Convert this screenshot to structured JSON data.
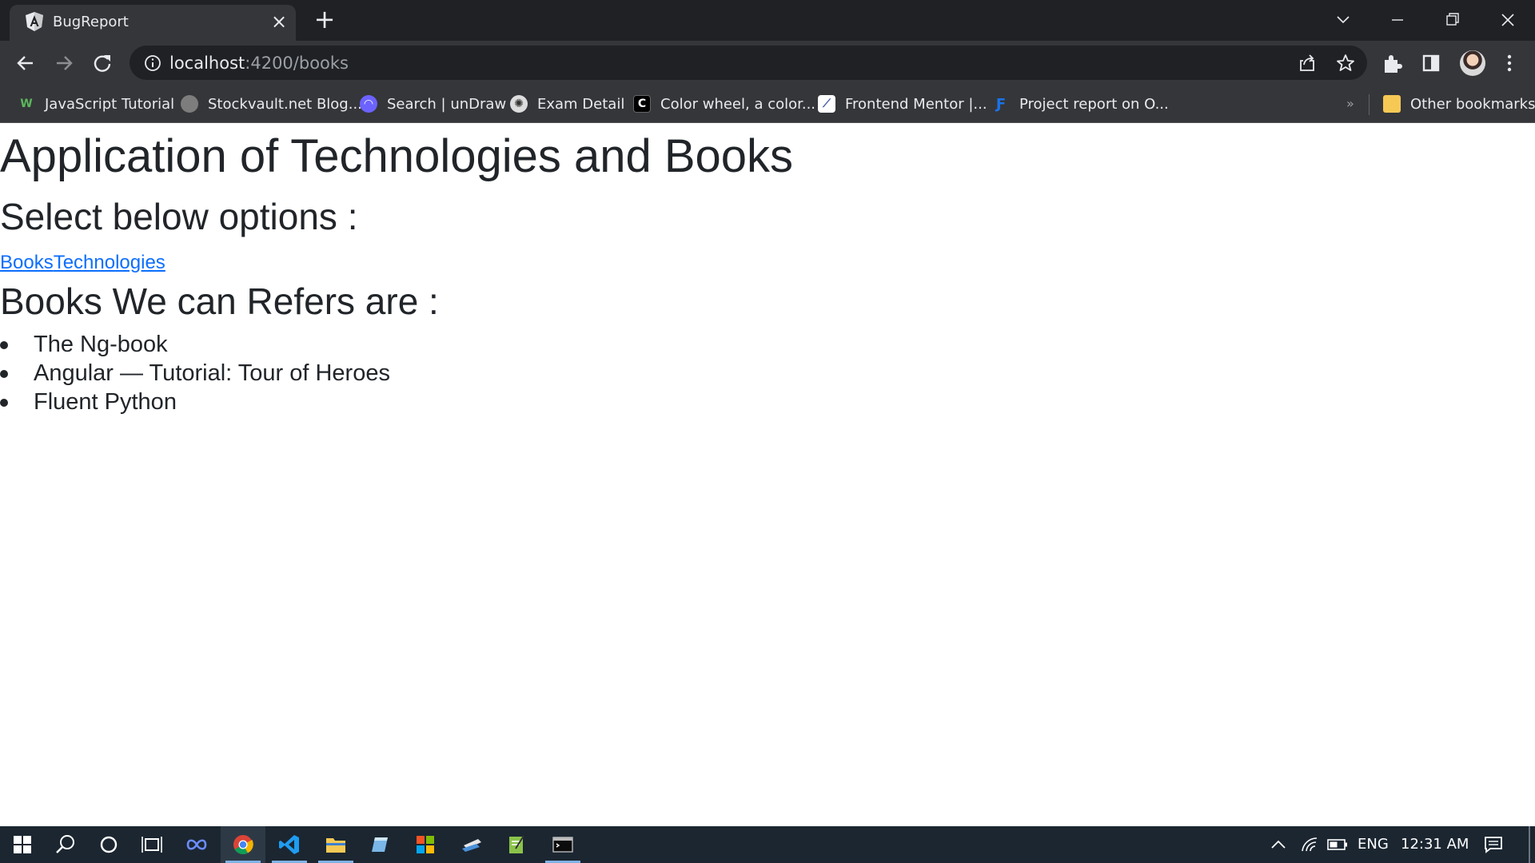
{
  "browser": {
    "tab_title": "BugReport",
    "url_host": "localhost",
    "url_rest": ":4200/books"
  },
  "bookmarks": [
    {
      "label": "JavaScript Tutorial",
      "icon": "w-icon",
      "color": "#5cb85c"
    },
    {
      "label": "Stockvault.net Blog...",
      "icon": "stockvault-icon",
      "color": "#8a8a8a"
    },
    {
      "label": "Search | unDraw",
      "icon": "undraw-icon",
      "color": "#6c63ff"
    },
    {
      "label": "Exam Detail",
      "icon": "exam-icon",
      "color": "#dddddd"
    },
    {
      "label": "Color wheel, a color...",
      "icon": "adobe-color-icon",
      "color": "#000000"
    },
    {
      "label": "Frontend Mentor |...",
      "icon": "frontend-mentor-icon",
      "color": "#ffffff"
    },
    {
      "label": "Project report on O...",
      "icon": "project-report-icon",
      "color": "#1a73e8"
    }
  ],
  "other_bookmarks": "Other bookmarks",
  "page": {
    "title": "Application of Technologies and Books",
    "subtitle": "Select below options :",
    "link_books": "Books",
    "link_technologies": "Technologies",
    "books_heading": "Books We can Refers are :",
    "books": [
      "The Ng-book",
      "Angular — Tutorial: Tour of Heroes",
      "Fluent Python"
    ]
  },
  "taskbar": {
    "language": "ENG",
    "time": "12:31 AM"
  },
  "colors": {
    "link": "#0d6efd",
    "chrome_dark": "#202124",
    "chrome": "#35363a",
    "taskbar": "#1b2631"
  }
}
